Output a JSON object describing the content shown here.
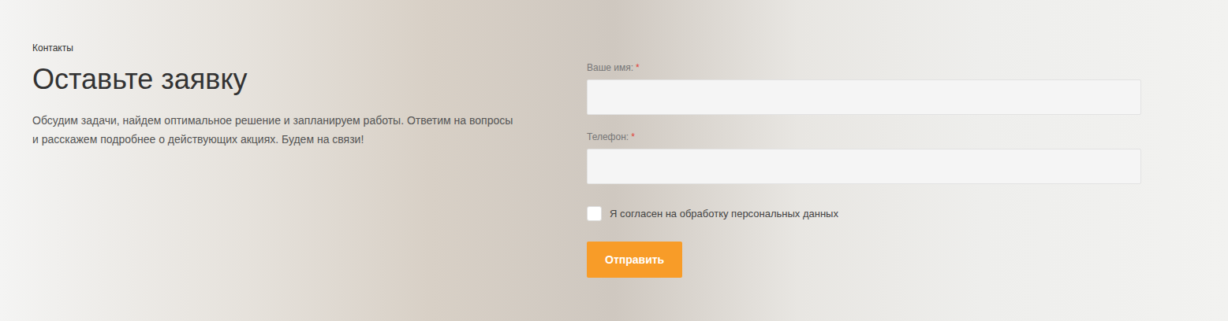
{
  "breadcrumb": "Контакты",
  "title": "Оставьте заявку",
  "description": "Обсудим задачи, найдем оптимальное решение и запланируем работы. Ответим на вопросы и расскажем подробнее о действующих акциях. Будем на связи!",
  "form": {
    "fields": [
      {
        "label": "Ваше имя:",
        "required_mark": "*"
      },
      {
        "label": "Телефон:",
        "required_mark": "*"
      }
    ],
    "consent": {
      "label": "Я согласен на обработку персональных данных",
      "checked": false
    },
    "submit": "Отправить"
  }
}
